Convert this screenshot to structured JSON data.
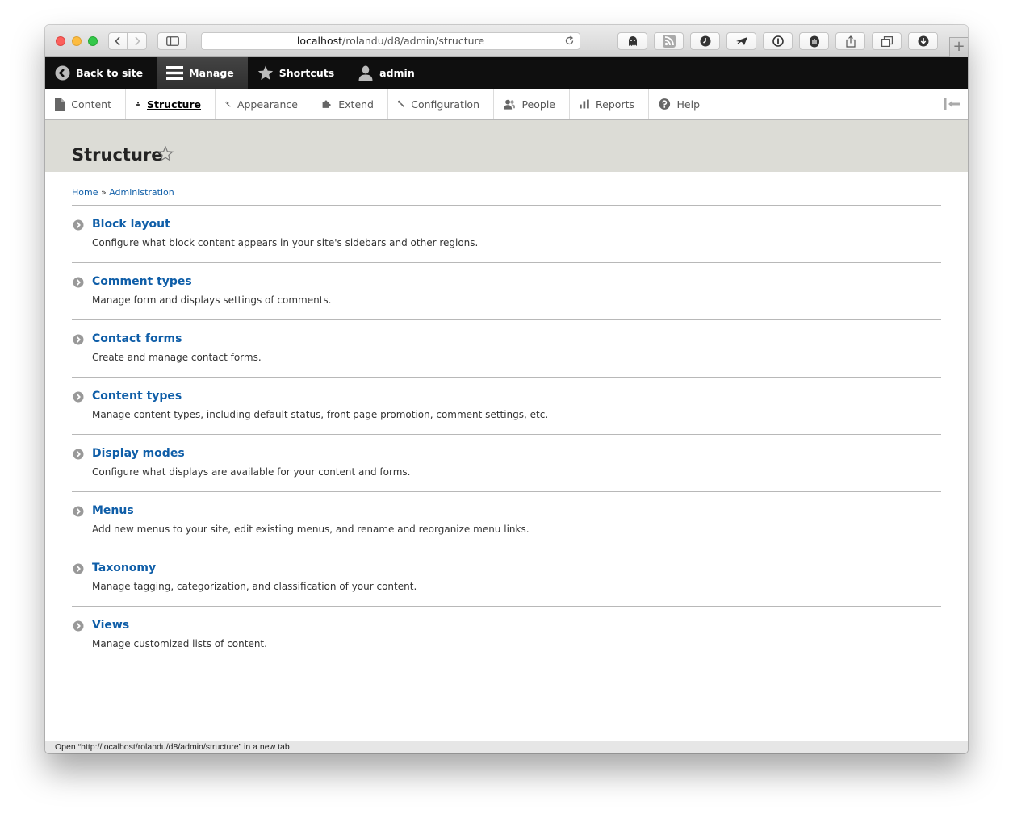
{
  "browser": {
    "url_host": "localhost",
    "url_path": "/rolandu/d8/admin/structure",
    "extensions": [
      "ghostery-icon",
      "rss-icon",
      "clock-icon",
      "paper-plane-icon",
      "info-icon",
      "hand-icon",
      "share-icon",
      "tabs-icon",
      "download-icon"
    ],
    "newtab_label": "+"
  },
  "toolbar": {
    "back": "Back to site",
    "manage": "Manage",
    "shortcuts": "Shortcuts",
    "user": "admin"
  },
  "tray": {
    "items": [
      {
        "label": "Content",
        "icon": "file-icon"
      },
      {
        "label": "Structure",
        "icon": "sitemap-icon"
      },
      {
        "label": "Appearance",
        "icon": "paintbrush-icon"
      },
      {
        "label": "Extend",
        "icon": "puzzle-icon"
      },
      {
        "label": "Configuration",
        "icon": "wrench-icon"
      },
      {
        "label": "People",
        "icon": "people-icon"
      },
      {
        "label": "Reports",
        "icon": "bar-chart-icon"
      },
      {
        "label": "Help",
        "icon": "help-icon"
      }
    ],
    "active": "Structure"
  },
  "page": {
    "title": "Structure",
    "breadcrumb": {
      "home": "Home",
      "separator": "»",
      "admin": "Administration"
    }
  },
  "items": [
    {
      "title": "Block layout",
      "desc": "Configure what block content appears in your site's sidebars and other regions."
    },
    {
      "title": "Comment types",
      "desc": "Manage form and displays settings of comments."
    },
    {
      "title": "Contact forms",
      "desc": "Create and manage contact forms."
    },
    {
      "title": "Content types",
      "desc": "Manage content types, including default status, front page promotion, comment settings, etc."
    },
    {
      "title": "Display modes",
      "desc": "Configure what displays are available for your content and forms."
    },
    {
      "title": "Menus",
      "desc": "Add new menus to your site, edit existing menus, and rename and reorganize menu links."
    },
    {
      "title": "Taxonomy",
      "desc": "Manage tagging, categorization, and classification of your content."
    },
    {
      "title": "Views",
      "desc": "Manage customized lists of content."
    }
  ],
  "statusbar": "Open “http://localhost/rolandu/d8/admin/structure” in a new tab",
  "colors": {
    "link": "#0f5ea8",
    "toolbar_bg": "#0f0f0f",
    "header_bg": "#dcdcd6"
  }
}
